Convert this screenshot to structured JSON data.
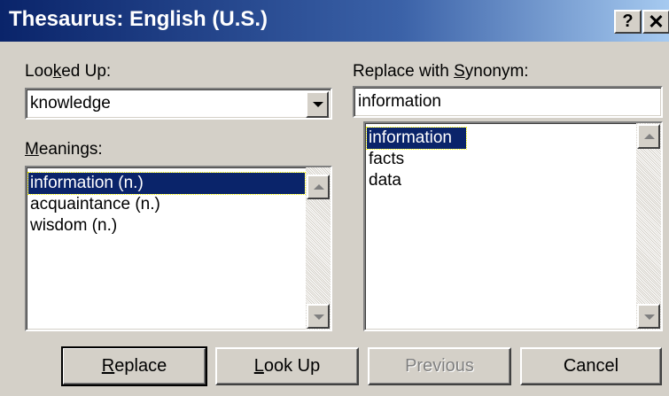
{
  "window": {
    "title": "Thesaurus: English (U.S.)",
    "help_glyph": "?",
    "close_glyph": "✕"
  },
  "looked_up": {
    "label_pre": "Loo",
    "label_mnemonic": "k",
    "label_post": "ed Up:",
    "value": "knowledge"
  },
  "meanings": {
    "label_mnemonic": "M",
    "label_post": "eanings:",
    "items": [
      "information (n.)",
      "acquaintance (n.)",
      "wisdom (n.)"
    ],
    "selected_index": 0
  },
  "replace_with": {
    "label_pre": "Replace with ",
    "label_mnemonic": "S",
    "label_post": "ynonym:",
    "value": "information",
    "items": [
      "information",
      "facts",
      "data"
    ],
    "selected_index": 0
  },
  "buttons": {
    "replace": {
      "mnemonic": "R",
      "rest": "eplace"
    },
    "look_up": {
      "mnemonic": "L",
      "rest": "ook Up"
    },
    "previous": {
      "label": "Previous",
      "enabled": false
    },
    "cancel": {
      "label": "Cancel"
    }
  },
  "colors": {
    "title_gradient_start": "#0a246a",
    "title_gradient_end": "#a6caf0",
    "face": "#d4d0c8",
    "selection": "#0a246a"
  }
}
